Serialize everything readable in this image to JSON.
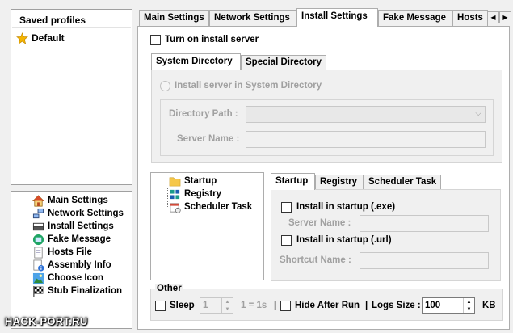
{
  "profiles": {
    "header": "Saved profiles",
    "items": [
      {
        "label": "Default",
        "icon": "star-icon"
      }
    ]
  },
  "nav": {
    "items": [
      {
        "label": "Main Settings",
        "icon": "home-icon"
      },
      {
        "label": "Network Settings",
        "icon": "network-icon"
      },
      {
        "label": "Install Settings",
        "icon": "install-icon"
      },
      {
        "label": "Fake Message",
        "icon": "message-icon"
      },
      {
        "label": "Hosts File",
        "icon": "hosts-file-icon"
      },
      {
        "label": "Assembly Info",
        "icon": "assembly-info-icon"
      },
      {
        "label": "Choose Icon",
        "icon": "choose-icon-icon"
      },
      {
        "label": "Stub Finalization",
        "icon": "checkered-flag-icon"
      }
    ]
  },
  "tabs": [
    "Main Settings",
    "Network Settings",
    "Install Settings",
    "Fake Message",
    "Hosts"
  ],
  "active_tab": "Install Settings",
  "install": {
    "turn_on_label": "Turn on install server",
    "dir_tabs": [
      "System Directory",
      "Special Directory"
    ],
    "radio_label": "Install server in System Directory",
    "dir_path_label": "Directory Path :",
    "server_name_label": "Server Name :"
  },
  "methods": {
    "tree": [
      "Startup",
      "Registry",
      "Scheduler Task"
    ],
    "tabs": [
      "Startup",
      "Registry",
      "Scheduler Task"
    ],
    "exe_label": "Install in startup (.exe)",
    "server_name_label": "Server Name :",
    "url_label": "Install in startup (.url)",
    "shortcut_name_label": "Shortcut Name :"
  },
  "other": {
    "title": "Other",
    "sleep_label": "Sleep",
    "sleep_value": "1",
    "ratio": "1 = 1s",
    "sep1": "|",
    "hide_label": "Hide After Run",
    "sep2": "|",
    "logs_label": "Logs Size :",
    "logs_value": "100",
    "logs_unit": "KB"
  },
  "watermark": "HACK-PORT.RU",
  "colors": {
    "accent": "#0078d7",
    "folder": "#f5c74a",
    "star": "#f4b400"
  }
}
